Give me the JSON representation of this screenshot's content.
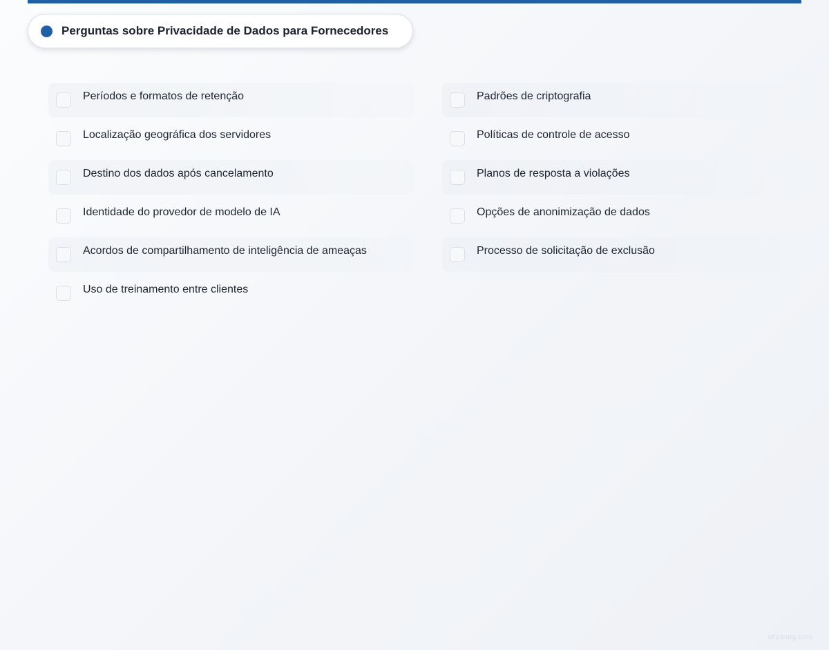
{
  "header": {
    "title": "Perguntas sobre Privacidade de Dados para Fornecedores",
    "accent_color": "#1f5fa6"
  },
  "checklist": {
    "left": [
      {
        "label": "Períodos e formatos de retenção",
        "checked": false
      },
      {
        "label": "Localização geográfica dos servidores",
        "checked": false
      },
      {
        "label": "Destino dos dados após cancelamento",
        "checked": false
      },
      {
        "label": "Identidade do provedor de modelo de IA",
        "checked": false
      },
      {
        "label": "Acordos de compartilhamento de inteligência de ameaças",
        "checked": false
      },
      {
        "label": "Uso de treinamento entre clientes",
        "checked": false
      }
    ],
    "right": [
      {
        "label": "Padrões de criptografia",
        "checked": false
      },
      {
        "label": "Políticas de controle de acesso",
        "checked": false
      },
      {
        "label": "Planos de resposta a violações",
        "checked": false
      },
      {
        "label": "Opções de anonimização de dados",
        "checked": false
      },
      {
        "label": "Processo de solicitação de exclusão",
        "checked": false
      }
    ]
  },
  "footer": {
    "watermark": "skysnag.com"
  }
}
